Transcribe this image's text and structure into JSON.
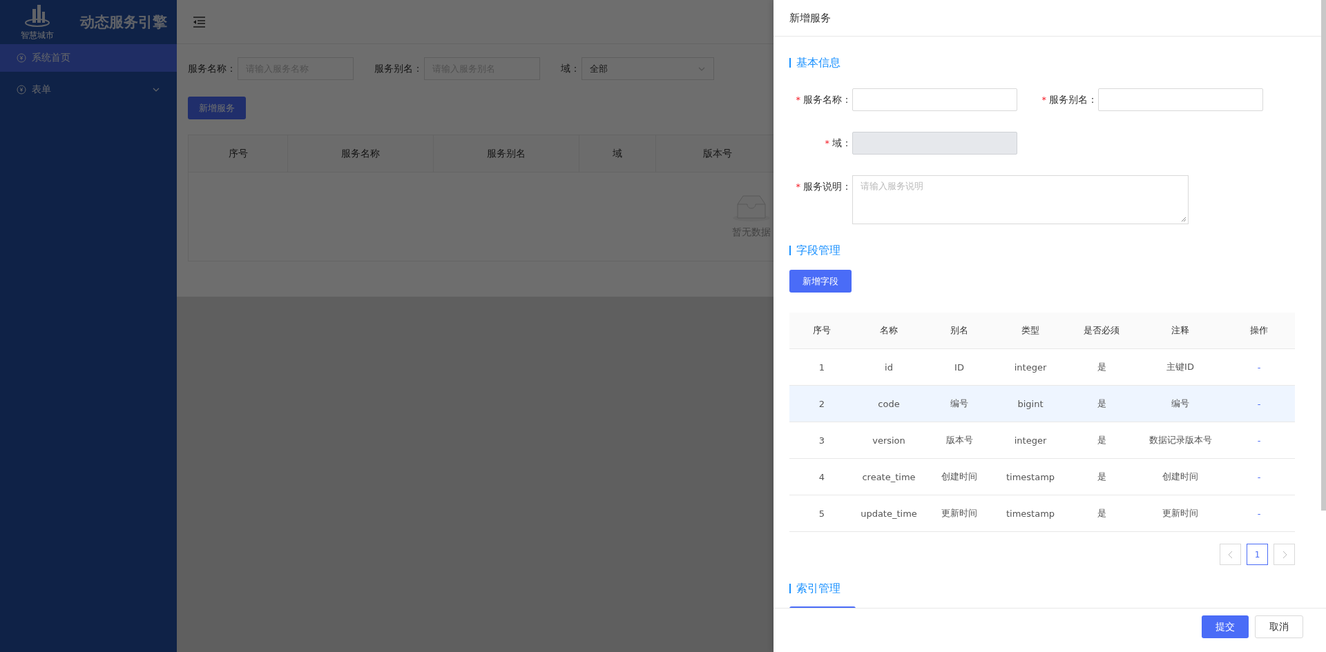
{
  "sidebar": {
    "logo_text": "智慧城市",
    "title": "动态服务引擎",
    "items": [
      {
        "label": "系统首页",
        "selected": true,
        "has_children": false
      },
      {
        "label": "表单",
        "selected": false,
        "has_children": true
      }
    ]
  },
  "filters": [
    {
      "kind": "input",
      "label": "服务名称：",
      "placeholder": "请输入服务名称"
    },
    {
      "kind": "input",
      "label": "服务别名：",
      "placeholder": "请输入服务别名"
    },
    {
      "kind": "select",
      "label": "域：",
      "value": "全部"
    }
  ],
  "add_button": "新增服务",
  "table": {
    "columns": [
      "序号",
      "服务名称",
      "服务别名",
      "域",
      "版本号"
    ],
    "empty_text": "暂无数据"
  },
  "drawer": {
    "title": "新增服务",
    "basic_info": {
      "title": "基本信息",
      "rows": [
        [
          {
            "kind": "input",
            "required_mark": "*",
            "label": "服务名称：",
            "disabled": false
          },
          {
            "kind": "input",
            "required_mark": "*",
            "label": "服务别名：",
            "disabled": false
          }
        ],
        [
          {
            "kind": "input",
            "required_mark": "*",
            "label": "域：",
            "disabled": true
          }
        ],
        [
          {
            "kind": "textarea",
            "required_mark": "*",
            "label": "服务说明：",
            "placeholder": "请输入服务说明"
          }
        ]
      ]
    },
    "fields": {
      "title": "字段管理",
      "add_button": "新增字段",
      "columns": [
        "序号",
        "名称",
        "别名",
        "类型",
        "是否必须",
        "注释",
        "操作"
      ],
      "rows": [
        {
          "selected": false,
          "cells": [
            "1",
            "id",
            "ID",
            "integer",
            "是",
            "主键ID",
            "-"
          ]
        },
        {
          "selected": true,
          "cells": [
            "2",
            "code",
            "编号",
            "bigint",
            "是",
            "编号",
            "-"
          ]
        },
        {
          "selected": false,
          "cells": [
            "3",
            "version",
            "版本号",
            "integer",
            "是",
            "数据记录版本号",
            "-"
          ]
        },
        {
          "selected": false,
          "cells": [
            "4",
            "create_time",
            "创建时间",
            "timestamp",
            "是",
            "创建时间",
            "-"
          ]
        },
        {
          "selected": false,
          "cells": [
            "5",
            "update_time",
            "更新时间",
            "timestamp",
            "是",
            "更新时间",
            "-"
          ]
        }
      ],
      "pages": [
        {
          "label": "1",
          "selected": true
        }
      ]
    },
    "index": {
      "title": "索引管理"
    },
    "footer": {
      "submit": "提交",
      "cancel": "取消"
    }
  }
}
